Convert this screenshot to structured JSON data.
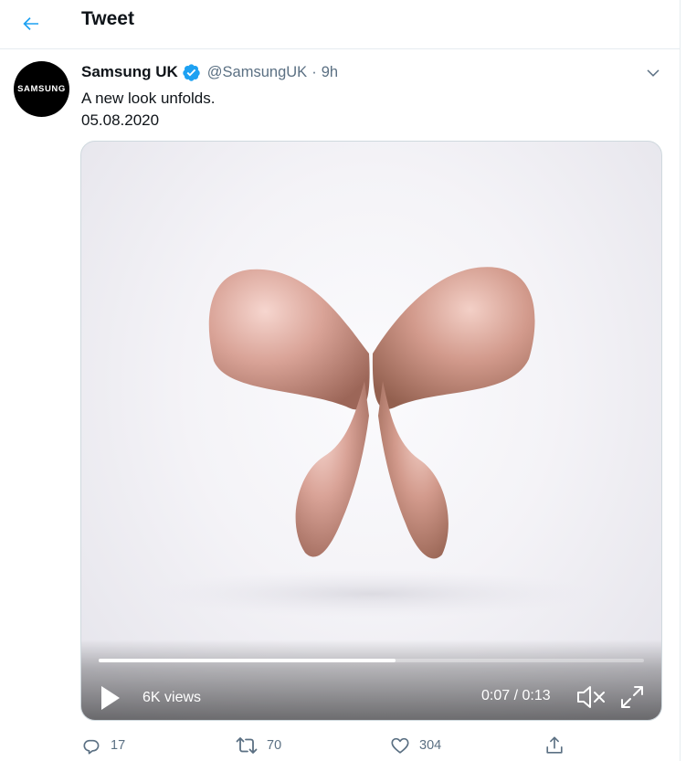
{
  "header": {
    "title": "Tweet",
    "back_icon": "arrow-left-icon"
  },
  "tweet": {
    "display_name": "Samsung UK",
    "verified_icon": "verified-badge-icon",
    "handle": "@SamsungUK",
    "separator": "·",
    "time": "9h",
    "avatar_text": "SAMSUNG",
    "text_lines": [
      "A new look unfolds.",
      "05.08.2020"
    ],
    "more_icon": "chevron-down-icon"
  },
  "video": {
    "views": "6K views",
    "timecode": "0:07 / 0:13",
    "progress": 0.545,
    "play_icon": "play-icon",
    "mute_icon": "speaker-muted-icon",
    "fullscreen_icon": "fullscreen-icon"
  },
  "actions": {
    "reply": {
      "icon": "reply-icon",
      "count": "17"
    },
    "retweet": {
      "icon": "retweet-icon",
      "count": "70"
    },
    "like": {
      "icon": "heart-icon",
      "count": "304"
    },
    "share": {
      "icon": "share-icon"
    }
  },
  "colors": {
    "accent": "#1da1f2",
    "secondary_text": "#5b7083",
    "primary_text": "#0f1419",
    "border": "#e6ecf0",
    "verified": "#1da1f2"
  }
}
